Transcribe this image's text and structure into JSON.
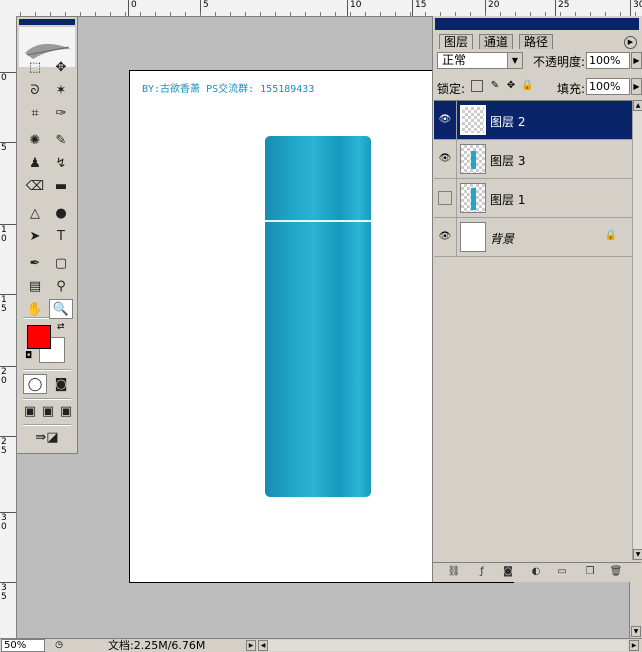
{
  "ruler": {
    "top_numbers": [
      "0",
      "5",
      "10",
      "15",
      "20",
      "25",
      "30"
    ],
    "left_numbers": [
      "0",
      "5",
      "1\n0",
      "1\n5",
      "2\n0",
      "2\n5",
      "3\n0",
      "3\n5"
    ]
  },
  "toolbox": {
    "tools": [
      {
        "name": "marquee-tool",
        "glyph": "⬚"
      },
      {
        "name": "move-tool",
        "glyph": "✥"
      },
      {
        "name": "lasso-tool",
        "glyph": "ᘐ"
      },
      {
        "name": "magic-wand-tool",
        "glyph": "✶"
      },
      {
        "name": "crop-tool",
        "glyph": "⌗"
      },
      {
        "name": "slice-tool",
        "glyph": "✑"
      },
      {
        "name": "healing-brush-tool",
        "glyph": "✺"
      },
      {
        "name": "brush-tool",
        "glyph": "✎"
      },
      {
        "name": "clone-stamp-tool",
        "glyph": "♟"
      },
      {
        "name": "history-brush-tool",
        "glyph": "↯"
      },
      {
        "name": "eraser-tool",
        "glyph": "⌫"
      },
      {
        "name": "gradient-tool",
        "glyph": "▬"
      },
      {
        "name": "blur-tool",
        "glyph": "△"
      },
      {
        "name": "dodge-tool",
        "glyph": "●"
      },
      {
        "name": "path-selection-tool",
        "glyph": "➤"
      },
      {
        "name": "type-tool",
        "glyph": "T"
      },
      {
        "name": "pen-tool",
        "glyph": "✒"
      },
      {
        "name": "shape-tool",
        "glyph": "▢"
      },
      {
        "name": "notes-tool",
        "glyph": "▤"
      },
      {
        "name": "eyedropper-tool",
        "glyph": "⚲"
      },
      {
        "name": "hand-tool",
        "glyph": "✋"
      },
      {
        "name": "zoom-tool",
        "glyph": "🔍"
      }
    ],
    "foreground_color": "#ff0000",
    "background_color": "#ffffff"
  },
  "canvas": {
    "credit_text": "BY:古欲香萧 PS交流群: 155189433",
    "bottle_color": "#1fa6c8"
  },
  "layers_panel": {
    "tabs": [
      "图层",
      "通道",
      "路径"
    ],
    "blend_mode": "正常",
    "opacity_label": "不透明度:",
    "opacity_value": "100%",
    "lock_label": "锁定:",
    "fill_label": "填充:",
    "fill_value": "100%",
    "layers": [
      {
        "name": "图层 2",
        "visible": true,
        "selected": true
      },
      {
        "name": "图层 3",
        "visible": true,
        "selected": false
      },
      {
        "name": "图层 1",
        "visible": false,
        "selected": false
      },
      {
        "name": "背景",
        "visible": true,
        "selected": false,
        "locked": true
      }
    ]
  },
  "status": {
    "zoom": "50%",
    "doc_size": "文档:2.25M/6.76M"
  },
  "colors": {
    "selection": "#0a246a",
    "chrome": "#d4d0c8",
    "workspace": "#bdbdbd"
  }
}
